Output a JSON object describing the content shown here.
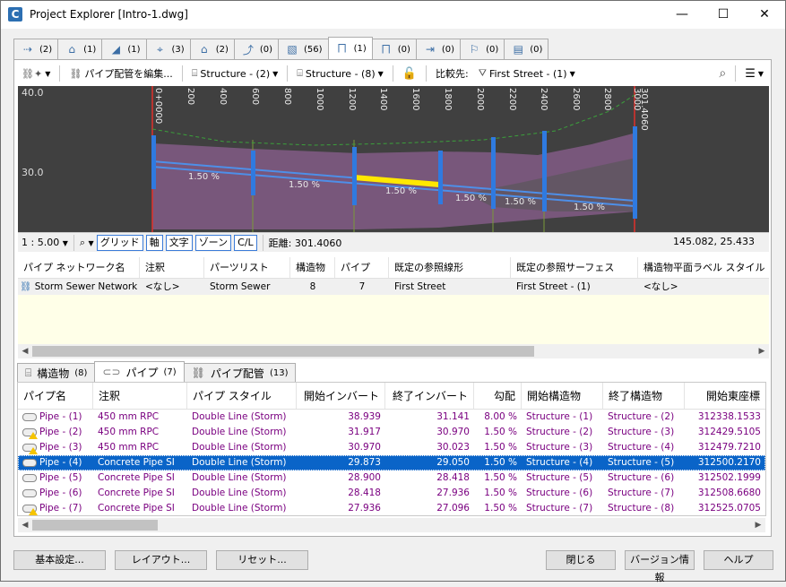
{
  "window": {
    "title": "Project Explorer [Intro-1.dwg]",
    "icon_letter": "C",
    "minimize": "—",
    "maximize": "☐",
    "close": "✕"
  },
  "top_tabs": [
    {
      "icon": "⇢",
      "count": "(2)"
    },
    {
      "icon": "⌂",
      "count": "(1)"
    },
    {
      "icon": "◢",
      "count": "(1)"
    },
    {
      "icon": "⌖",
      "count": "(3)"
    },
    {
      "icon": "⌂",
      "count": "(2)"
    },
    {
      "icon": "⤴",
      "count": "(0)"
    },
    {
      "icon": "▧",
      "count": "(56)"
    },
    {
      "icon": "⨅",
      "count": "(1)"
    },
    {
      "icon": "⨅",
      "count": "(0)"
    },
    {
      "icon": "⇥",
      "count": "(0)"
    },
    {
      "icon": "⚐",
      "count": "(0)"
    },
    {
      "icon": "▤",
      "count": "(0)"
    }
  ],
  "toolbar": {
    "edit_label": "パイプ配管を編集...",
    "structure1": "Structure - (2)",
    "structure2": "Structure - (8)",
    "compare_label": "比較先:",
    "compare_value": "First Street - (1)"
  },
  "profile": {
    "y_labels": [
      "40.0",
      "30.0"
    ],
    "stations": [
      "0+0000",
      "200",
      "400",
      "600",
      "800",
      "1000",
      "1200",
      "1400",
      "1600",
      "1800",
      "2000",
      "2200",
      "2400",
      "2600",
      "2800",
      "3000",
      "301.4060"
    ],
    "slope_labels": [
      "1.50 %",
      "1.50 %",
      "1.50 %",
      "1.50 %",
      "1.50 %",
      "1.50 %"
    ]
  },
  "chart_toolbar": {
    "scale": "1 : 5.00",
    "grid": "グリッド",
    "axis": "軸",
    "text": "文字",
    "zone": "ゾーン",
    "cl": "C/L",
    "distance": "距離: 301.4060",
    "coordinates": "145.082, 25.433"
  },
  "network_grid": {
    "headers": [
      "パイプ ネットワーク名",
      "注釈",
      "パーツリスト",
      "構造物",
      "パイプ",
      "既定の参照線形",
      "既定の参照サーフェス",
      "構造物平面ラベル スタイル"
    ],
    "row": [
      "Storm Sewer Network",
      "<なし>",
      "Storm Sewer",
      "8",
      "7",
      "First Street",
      "First Street - (1)",
      "<なし>"
    ]
  },
  "bottom_tabs": [
    {
      "label": "構造物",
      "count": "(8)"
    },
    {
      "label": "パイプ",
      "count": "(7)"
    },
    {
      "label": "パイプ配管",
      "count": "(13)"
    }
  ],
  "pipe_grid": {
    "headers": [
      "パイプ名",
      "注釈",
      "パイプ スタイル",
      "開始インバート",
      "終了インバート",
      "勾配",
      "開始構造物",
      "終了構造物",
      "開始東座標"
    ],
    "rows": [
      [
        "Pipe - (1)",
        "450 mm RPC",
        "Double Line (Storm)",
        "38.939",
        "31.141",
        "8.00 %",
        "Structure - (1)",
        "Structure - (2)",
        "312338.1533"
      ],
      [
        "Pipe - (2)",
        "450 mm RPC",
        "Double Line (Storm)",
        "31.917",
        "30.970",
        "1.50 %",
        "Structure - (2)",
        "Structure - (3)",
        "312429.5105"
      ],
      [
        "Pipe - (3)",
        "450 mm RPC",
        "Double Line (Storm)",
        "30.970",
        "30.023",
        "1.50 %",
        "Structure - (3)",
        "Structure - (4)",
        "312479.7210"
      ],
      [
        "Pipe - (4)",
        "Concrete Pipe SI",
        "Double Line (Storm)",
        "29.873",
        "29.050",
        "1.50 %",
        "Structure - (4)",
        "Structure - (5)",
        "312500.2170"
      ],
      [
        "Pipe - (5)",
        "Concrete Pipe SI",
        "Double Line (Storm)",
        "28.900",
        "28.418",
        "1.50 %",
        "Structure - (5)",
        "Structure - (6)",
        "312502.1999"
      ],
      [
        "Pipe - (6)",
        "Concrete Pipe SI",
        "Double Line (Storm)",
        "28.418",
        "27.936",
        "1.50 %",
        "Structure - (6)",
        "Structure - (7)",
        "312508.6680"
      ],
      [
        "Pipe - (7)",
        "Concrete Pipe SI",
        "Double Line (Storm)",
        "27.936",
        "27.096",
        "1.50 %",
        "Structure - (7)",
        "Structure - (8)",
        "312525.0705"
      ]
    ]
  },
  "buttons": {
    "settings": "基本設定...",
    "layout": "レイアウト...",
    "reset": "リセット...",
    "close": "閉じる",
    "version": "バージョン情報",
    "help": "ヘルプ"
  }
}
